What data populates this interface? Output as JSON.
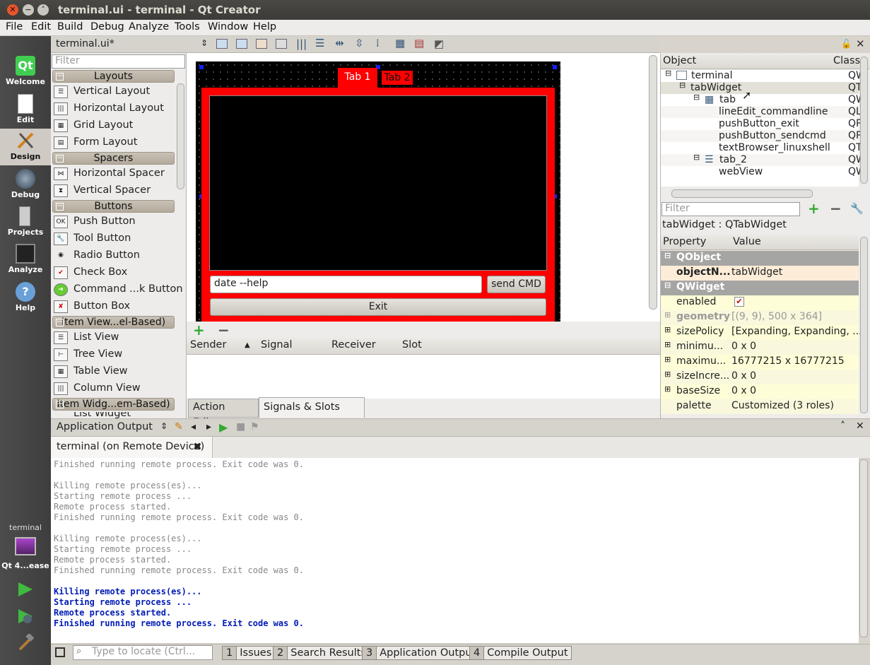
{
  "window": {
    "title": "terminal.ui - terminal - Qt Creator"
  },
  "menu": [
    "File",
    "Edit",
    "Build",
    "Debug",
    "Analyze",
    "Tools",
    "Window",
    "Help"
  ],
  "modes": [
    {
      "label": "Welcome",
      "icon": "qt-logo-icon"
    },
    {
      "label": "Edit",
      "icon": "document-icon"
    },
    {
      "label": "Design",
      "icon": "design-pen-icon"
    },
    {
      "label": "Debug",
      "icon": "bug-icon"
    },
    {
      "label": "Projects",
      "icon": "projects-icon"
    },
    {
      "label": "Analyze",
      "icon": "analyze-icon"
    },
    {
      "label": "Help",
      "icon": "help-icon"
    }
  ],
  "kit": {
    "project": "terminal",
    "target": "Qt 4...ease"
  },
  "editor": {
    "file": "terminal.ui*"
  },
  "widgetbox": {
    "filter_placeholder": "Filter",
    "categories": {
      "layouts": "Layouts",
      "spacers": "Spacers",
      "buttons": "Buttons",
      "itemviews": "Item View...el-Based)",
      "itemwidgets": "Item Widg...em-Based)"
    },
    "items": {
      "vlayout": "Vertical Layout",
      "hlayout": "Horizontal Layout",
      "grid": "Grid Layout",
      "form": "Form Layout",
      "hspacer": "Horizontal Spacer",
      "vspacer": "Vertical Spacer",
      "push": "Push Button",
      "tool": "Tool Button",
      "radio": "Radio Button",
      "check": "Check Box",
      "command": "Command ...k Button",
      "buttonbox": "Button Box",
      "listview": "List View",
      "treeview": "Tree View",
      "tableview": "Table View",
      "columnview": "Column View",
      "listwidget": "List Widget"
    }
  },
  "form": {
    "tab1": "Tab 1",
    "tab2": "Tab 2",
    "line_edit": "date --help",
    "send_button": "send CMD",
    "exit_button": "Exit"
  },
  "signals": {
    "columns": [
      "Sender",
      "Signal",
      "Receiver",
      "Slot"
    ],
    "tabs": [
      "Action Editor",
      "Signals & Slots Editor"
    ]
  },
  "object_inspector": {
    "headers": [
      "Object",
      "Class"
    ],
    "rows": [
      {
        "name": "terminal",
        "class": "QW"
      },
      {
        "name": "tabWidget",
        "class": "QT"
      },
      {
        "name": "tab",
        "class": "QW"
      },
      {
        "name": "lineEdit_commandline",
        "class": "QL"
      },
      {
        "name": "pushButton_exit",
        "class": "QP"
      },
      {
        "name": "pushButton_sendcmd",
        "class": "QP"
      },
      {
        "name": "textBrowser_linuxshell",
        "class": "QT"
      },
      {
        "name": "tab_2",
        "class": "QW"
      },
      {
        "name": "webView",
        "class": "QW"
      }
    ]
  },
  "property_editor": {
    "filter_placeholder": "Filter",
    "current": "tabWidget : QTabWidget",
    "headers": [
      "Property",
      "Value"
    ],
    "sections": [
      "QObject",
      "QWidget"
    ],
    "rows": [
      {
        "name": "objectN...",
        "value": "tabWidget"
      },
      {
        "name": "enabled",
        "value": "✔"
      },
      {
        "name": "geometry",
        "value": "[(9, 9), 500 x 364]"
      },
      {
        "name": "sizePolicy",
        "value": "[Expanding, Expanding, ..."
      },
      {
        "name": "minimu...",
        "value": "0 x 0"
      },
      {
        "name": "maximu...",
        "value": "16777215 x 16777215"
      },
      {
        "name": "sizeIncre...",
        "value": "0 x 0"
      },
      {
        "name": "baseSize",
        "value": "0 x 0"
      },
      {
        "name": "palette",
        "value": "Customized (3 roles)"
      }
    ]
  },
  "output": {
    "pane_title": "Application Output",
    "tab_label": "terminal (on Remote Device)",
    "lines": [
      "Finished running remote process. Exit code was 0.",
      "",
      "Killing remote process(es)...",
      "Starting remote process ...",
      "Remote process started.",
      "Finished running remote process. Exit code was 0.",
      "",
      "Killing remote process(es)...",
      "Starting remote process ...",
      "Remote process started.",
      "Finished running remote process. Exit code was 0.",
      "",
      "Killing remote process(es)...",
      "Starting remote process ...",
      "Remote process started.",
      "Finished running remote process. Exit code was 0."
    ]
  },
  "statusbar": {
    "locate_placeholder": "Type to locate (Ctrl...",
    "tabs": [
      {
        "num": "1",
        "label": "Issues"
      },
      {
        "num": "2",
        "label": "Search Results"
      },
      {
        "num": "3",
        "label": "Application Output"
      },
      {
        "num": "4",
        "label": "Compile Output"
      }
    ]
  },
  "colors": {
    "form_bg": "#000000",
    "tab_frame": "#ff0000",
    "output_highlight": "#001bb5"
  }
}
